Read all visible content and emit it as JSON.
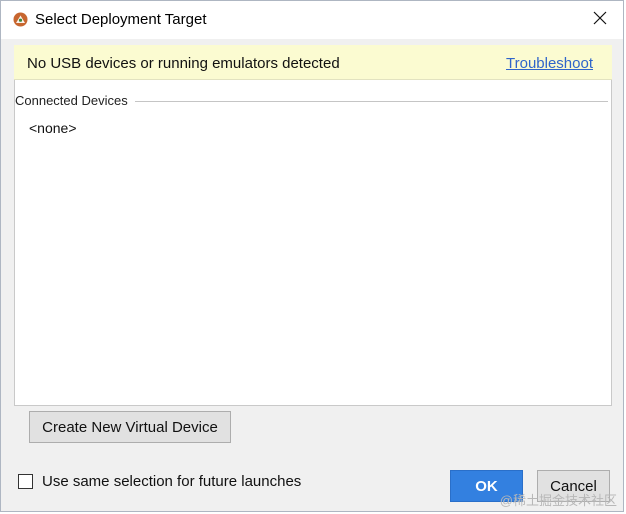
{
  "window": {
    "title": "Select Deployment Target",
    "app_icon": "android-studio-icon",
    "close_icon": "close-icon"
  },
  "banner": {
    "message": "No USB devices or running emulators detected",
    "link_label": "Troubleshoot",
    "background": "#fbfbd1",
    "link_color": "#2f65ca"
  },
  "devices": {
    "group_title": "Connected Devices",
    "items": [
      "<none>"
    ]
  },
  "actions": {
    "create_label": "Create New Virtual Device",
    "checkbox_label": "Use same selection for future launches",
    "checkbox_checked": false,
    "ok_label": "OK",
    "cancel_label": "Cancel",
    "ok_color": "#3380e0"
  },
  "watermark": "@稀土掘金技术社区"
}
